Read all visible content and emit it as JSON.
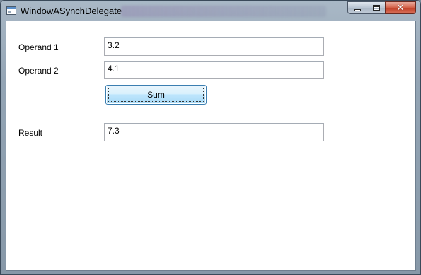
{
  "window": {
    "title": "WindowASynchDelegate",
    "icon": "window-app-icon",
    "caption_buttons": [
      "minimize-icon",
      "maximize-icon",
      "close-icon"
    ]
  },
  "form": {
    "operand1_label": "Operand 1",
    "operand1_value": "3.2",
    "operand2_label": "Operand 2",
    "operand2_value": "4.1",
    "sum_button": "Sum",
    "result_label": "Result",
    "result_value": "7.3"
  },
  "colors": {
    "button_border": "#3c7fb1",
    "close_button": "#c2432b"
  }
}
